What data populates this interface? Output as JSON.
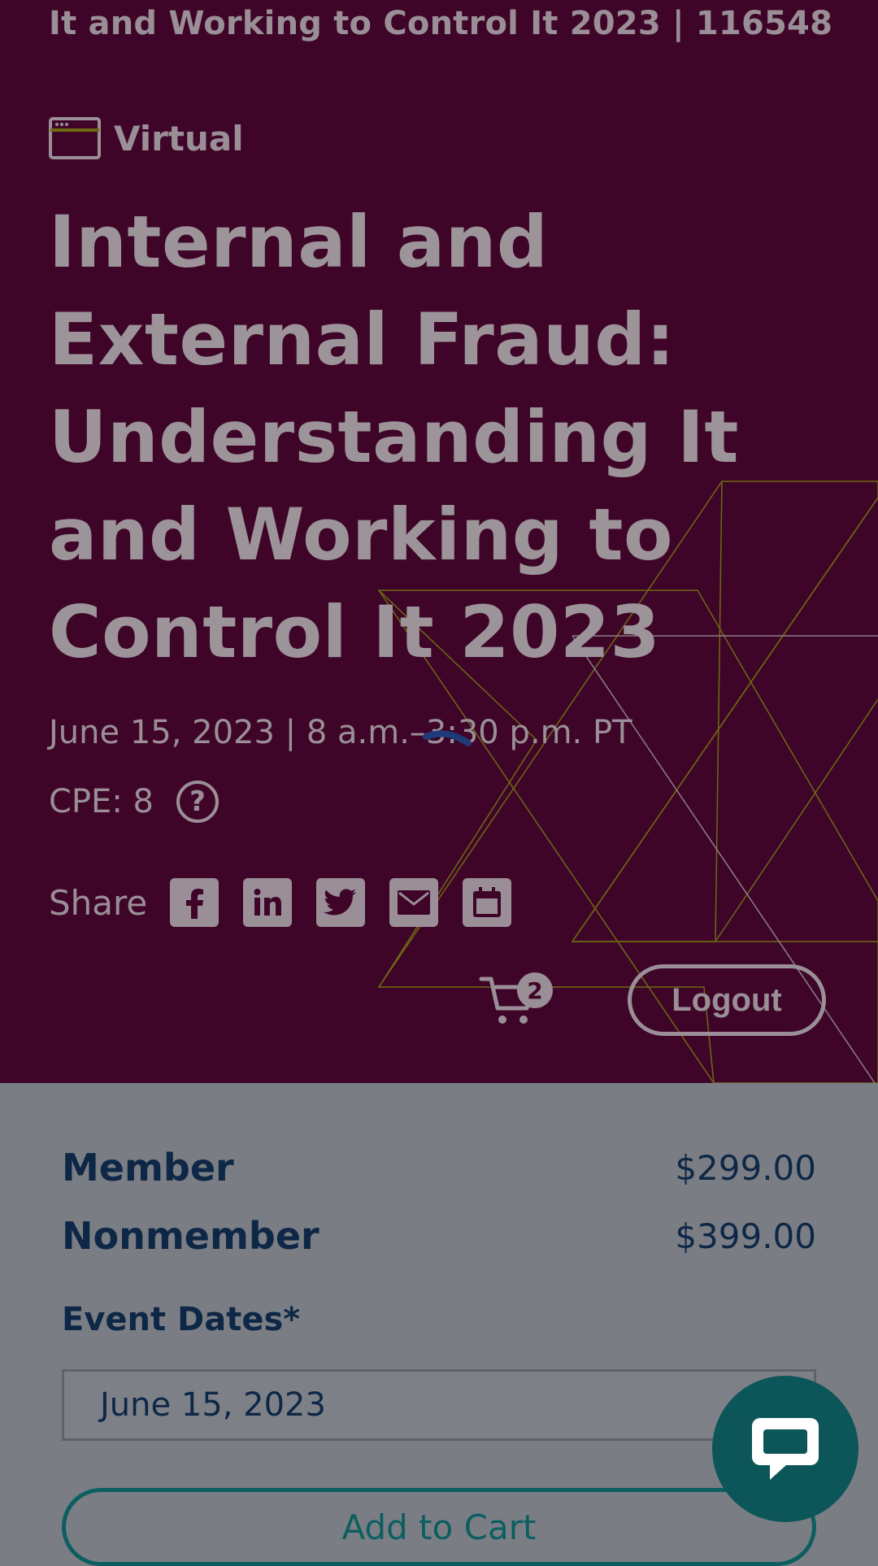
{
  "hero": {
    "breadcrumb_title": "It and Working to Control It 2023 | 116548",
    "format_label": "Virtual",
    "title": "Internal and External Fraud: Understanding It and Working to Control It 2023",
    "date": "June 15, 2023 | 8 a.m.–3:30 p.m. PT",
    "cpe_label": "CPE: 8",
    "help_glyph": "?",
    "share_label": "Share",
    "share_icons": [
      "facebook-icon",
      "linkedin-icon",
      "twitter-icon",
      "email-icon",
      "calendar-icon"
    ],
    "cart_count": "2",
    "logout_label": "Logout"
  },
  "pricing": {
    "member_label": "Member",
    "member_price": "$299.00",
    "nonmember_label": "Nonmember",
    "nonmember_price": "$399.00"
  },
  "registration": {
    "event_dates_label": "Event Dates*",
    "selected_date": "June 15, 2023",
    "add_to_cart_label": "Add to Cart"
  },
  "colors": {
    "hero_bg": "#3f0529",
    "text_muted": "#9a8f96",
    "navy": "#0e2746",
    "teal": "#0c5e60",
    "accent_lines": "#6e6a10"
  }
}
